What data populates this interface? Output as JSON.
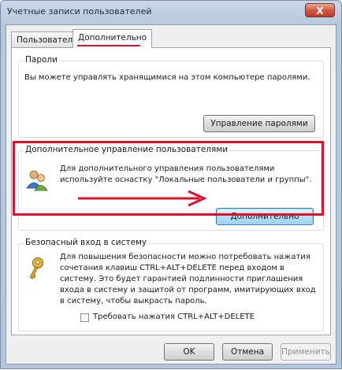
{
  "window": {
    "title": "Учетные записи пользователей",
    "close_glyph": "X"
  },
  "tabs": [
    {
      "label": "Пользователи"
    },
    {
      "label": "Дополнительно"
    }
  ],
  "passwords": {
    "label": "Пароли",
    "text": "Вы можете управлять хранящимися на этом компьютере паролями.",
    "button": "Управление паролями"
  },
  "advanced_users": {
    "label": "Дополнительное управление пользователями",
    "text_line1": "Для дополнительного управления пользователями",
    "text_line2": "используйте оснастку \"Локальные пользователи и группы\".",
    "button": "Дополнительно"
  },
  "secure_logon": {
    "label": "Безопасный вход в систему",
    "lines": [
      "Для повышения безопасности можно потребовать нажатия",
      "сочетания клавиш CTRL+ALT+DELETE перед входом в",
      "систему. Это будет гарантией подлинности приглашения",
      "входа в систему и защитой от программ, имитирующих вход",
      "в систему, чтобы выкрасть пароль."
    ],
    "checkbox_label": "Требовать нажатия CTRL+ALT+DELETE",
    "checkbox_checked": false
  },
  "footer": {
    "ok": "OK",
    "cancel": "Отмена",
    "apply": "Применить"
  },
  "colors": {
    "highlight": "#e0102a"
  }
}
